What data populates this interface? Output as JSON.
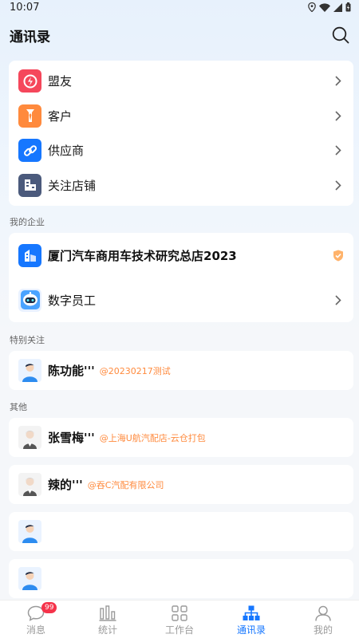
{
  "status_bar": {
    "time": "10:07"
  },
  "header": {
    "title": "通讯录"
  },
  "menu": [
    {
      "label": "盟友",
      "icon": "ally-icon",
      "color": "#f5475b"
    },
    {
      "label": "客户",
      "icon": "customer-icon",
      "color": "#ff8a3d"
    },
    {
      "label": "供应商",
      "icon": "supplier-link-icon",
      "color": "#1677ff"
    },
    {
      "label": "关注店铺",
      "icon": "store-icon",
      "color": "#4b5a7c"
    }
  ],
  "enterprise": {
    "section_label": "我的企业",
    "company_name": "厦门汽车商用车技术研究总店2023",
    "digital_staff_label": "数字员工"
  },
  "special": {
    "section_label": "特别关注",
    "contacts": [
      {
        "name": "陈功能'''",
        "tag": "@20230217测试"
      }
    ]
  },
  "others": {
    "section_label": "其他",
    "contacts": [
      {
        "name": "张雪梅'''",
        "tag": "@上海U航汽配店-云仓打包"
      },
      {
        "name": "辣的'''",
        "tag": "@吞C汽配有限公司"
      },
      {
        "name": "",
        "tag": ""
      },
      {
        "name": "",
        "tag": ""
      }
    ]
  },
  "tabbar": {
    "tabs": [
      {
        "label": "消息",
        "badge": "99"
      },
      {
        "label": "统计"
      },
      {
        "label": "工作台"
      },
      {
        "label": "通讯录"
      },
      {
        "label": "我的"
      }
    ],
    "active_color": "#1677ff"
  }
}
